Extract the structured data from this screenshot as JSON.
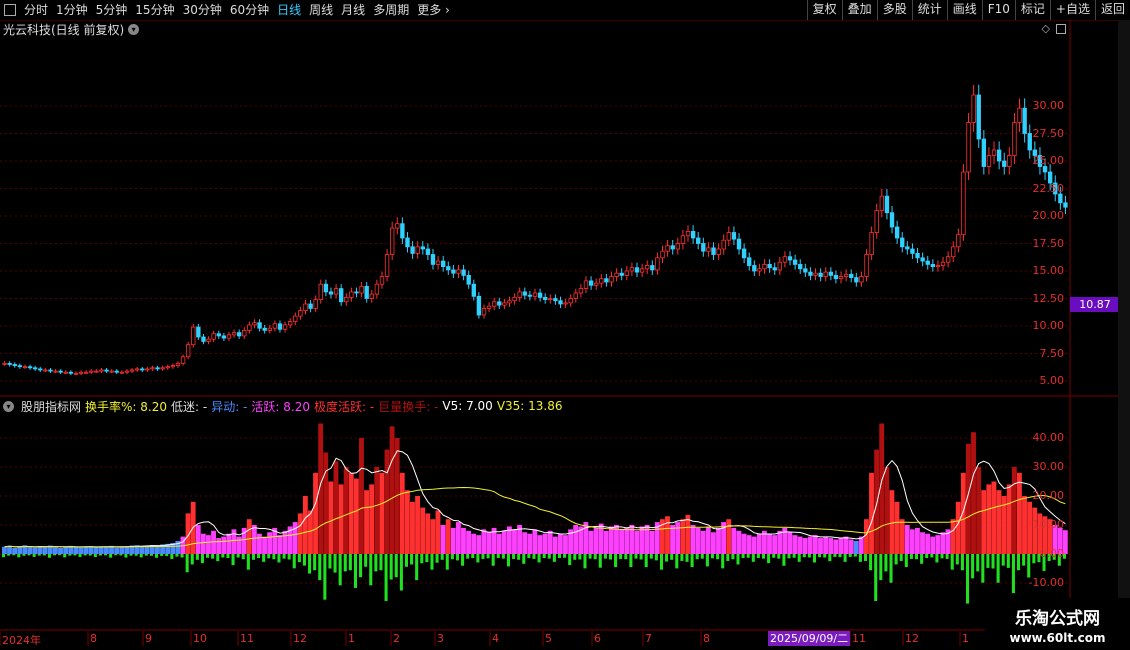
{
  "toolbar": {
    "periods": [
      "分时",
      "1分钟",
      "5分钟",
      "15分钟",
      "30分钟",
      "60分钟",
      "日线",
      "周线",
      "月线",
      "多周期",
      "更多"
    ],
    "active_index": 6,
    "right_buttons": [
      "复权",
      "叠加",
      "多股",
      "统计",
      "画线",
      "F10",
      "标记",
      "+自选",
      "返回"
    ]
  },
  "stock": {
    "name": "光云科技(日线 前复权)"
  },
  "price_axis": [
    "30.00",
    "27.50",
    "25.00",
    "22.50",
    "20.00",
    "17.50",
    "15.00",
    "12.50",
    "10.00",
    "7.50",
    "5.00"
  ],
  "current_price": "10.87",
  "indicator": {
    "name": "股朋指标网",
    "fields": [
      {
        "text": "换手率%: 8.20",
        "color": "#f0f030"
      },
      {
        "text": "低迷: -",
        "color": "#dddddd"
      },
      {
        "text": "异动: -",
        "color": "#4a8cff"
      },
      {
        "text": "活跃: 8.20",
        "color": "#ff40ff"
      },
      {
        "text": "极度活跃: -",
        "color": "#ff3030"
      },
      {
        "text": "巨量换手: -",
        "color": "#b01010"
      },
      {
        "text": "V5: 7.00",
        "color": "#ffffff"
      },
      {
        "text": "V35: 13.86",
        "color": "#f0f030"
      }
    ],
    "axis": [
      "40.00",
      "30.00",
      "20.00",
      "10.00",
      "0.00",
      "-10.00"
    ]
  },
  "dates": [
    "2024年",
    "8",
    "9",
    "10",
    "11",
    "12",
    "1",
    "2",
    "3",
    "4",
    "5",
    "6",
    "7",
    "8",
    "11",
    "12",
    "1"
  ],
  "date_tag": "2025/09/09/二",
  "brand": {
    "title": "乐淘公式网",
    "url": "www.60lt.com"
  },
  "colors": {
    "up": "#ff3030",
    "down": "#30d0ff",
    "grid": "#5a0000",
    "turnover_low": "#4a8cff",
    "turnover_active": "#ff40ff",
    "turnover_extreme": "#ff3030",
    "turnover_huge": "#b01010",
    "negative": "#20e020"
  },
  "chart_data": {
    "type": "candlestick",
    "ylim": [
      4,
      36
    ],
    "close": [
      6.6,
      6.5,
      6.4,
      6.3,
      6.3,
      6.2,
      6.1,
      6.0,
      6.0,
      5.9,
      5.9,
      5.8,
      5.8,
      5.7,
      5.7,
      5.8,
      5.8,
      5.9,
      5.9,
      6.0,
      5.9,
      5.9,
      5.8,
      5.8,
      5.9,
      6.0,
      6.1,
      6.0,
      6.1,
      6.2,
      6.1,
      6.2,
      6.3,
      6.4,
      6.6,
      7.2,
      8.3,
      9.9,
      9.0,
      8.6,
      8.8,
      9.3,
      9.1,
      8.9,
      9.2,
      9.4,
      9.1,
      9.6,
      10.1,
      10.3,
      9.8,
      9.6,
      9.8,
      10.2,
      9.7,
      10.1,
      10.4,
      10.9,
      11.4,
      12.0,
      11.6,
      12.4,
      13.8,
      13.1,
      12.9,
      13.4,
      12.2,
      12.6,
      13.1,
      13.0,
      13.6,
      12.5,
      12.9,
      13.8,
      14.5,
      16.5,
      18.9,
      19.3,
      18.0,
      17.2,
      16.6,
      17.2,
      17.0,
      16.5,
      15.6,
      15.9,
      15.4,
      15.1,
      14.8,
      15.1,
      14.6,
      13.8,
      12.7,
      11.0,
      11.6,
      11.8,
      12.2,
      11.9,
      12.1,
      12.3,
      12.6,
      13.1,
      12.8,
      12.7,
      13.0,
      12.6,
      12.4,
      12.5,
      12.3,
      12.0,
      12.1,
      12.5,
      13.0,
      13.4,
      14.1,
      13.7,
      13.9,
      14.3,
      14.0,
      14.5,
      14.8,
      14.6,
      15.0,
      15.3,
      14.9,
      15.2,
      15.5,
      15.1,
      16.2,
      16.8,
      17.3,
      17.0,
      17.5,
      18.2,
      18.6,
      18.0,
      17.5,
      16.8,
      17.1,
      16.5,
      17.0,
      17.8,
      18.5,
      17.9,
      17.0,
      16.2,
      15.5,
      15.0,
      15.2,
      15.6,
      15.3,
      15.1,
      15.8,
      16.3,
      16.0,
      15.6,
      15.2,
      14.9,
      14.6,
      14.8,
      14.5,
      14.9,
      14.6,
      14.3,
      14.5,
      14.7,
      14.4,
      14.0,
      14.5,
      16.5,
      18.5,
      20.5,
      21.8,
      20.3,
      19.0,
      18.0,
      17.2,
      17.0,
      16.6,
      16.2,
      15.9,
      15.6,
      15.4,
      15.5,
      15.8,
      16.3,
      17.2,
      18.3,
      24.0,
      28.5,
      31.0,
      27.0,
      24.5,
      25.5,
      26.0,
      25.0,
      24.5,
      25.5,
      28.5,
      29.8,
      27.5,
      26.0,
      25.5,
      24.5,
      24.0,
      23.0,
      22.0,
      21.2,
      20.8
    ],
    "turnover": [
      2.5,
      2.8,
      2.1,
      2.6,
      3.0,
      2.4,
      2.2,
      2.7,
      2.5,
      2.9,
      2.3,
      2.1,
      2.6,
      2.8,
      2.4,
      2.2,
      2.5,
      2.7,
      2.3,
      2.6,
      2.4,
      2.8,
      2.2,
      2.5,
      2.7,
      2.9,
      3.0,
      2.6,
      2.8,
      3.1,
      2.9,
      3.3,
      3.5,
      3.8,
      4.5,
      6.0,
      14.0,
      18.0,
      10.0,
      7.0,
      6.5,
      8.0,
      5.5,
      6.0,
      7.0,
      8.5,
      6.0,
      9.0,
      12.0,
      10.0,
      7.0,
      6.0,
      7.5,
      9.0,
      6.5,
      8.0,
      9.5,
      11.0,
      14.0,
      20.0,
      15.0,
      28.0,
      45.0,
      35.0,
      25.0,
      32.0,
      24.0,
      30.0,
      28.0,
      26.0,
      40.0,
      22.0,
      24.0,
      30.0,
      28.0,
      36.0,
      44.0,
      40.0,
      28.0,
      22.0,
      18.0,
      20.0,
      16.0,
      14.0,
      12.0,
      15.0,
      10.0,
      12.0,
      9.0,
      11.0,
      9.0,
      8.0,
      7.0,
      6.5,
      8.5,
      7.5,
      9.0,
      7.0,
      8.0,
      9.5,
      8.5,
      10.0,
      7.5,
      7.0,
      8.5,
      6.5,
      7.0,
      8.0,
      6.0,
      7.0,
      6.5,
      8.5,
      10.0,
      9.5,
      11.0,
      8.0,
      9.0,
      10.5,
      8.0,
      9.5,
      10.0,
      8.5,
      9.0,
      10.0,
      8.0,
      9.5,
      10.0,
      8.0,
      11.0,
      12.0,
      13.0,
      10.0,
      11.0,
      12.0,
      13.5,
      10.0,
      9.0,
      8.0,
      9.5,
      7.5,
      9.0,
      11.0,
      12.0,
      9.0,
      8.0,
      7.0,
      6.5,
      6.0,
      7.0,
      8.0,
      7.0,
      6.5,
      8.0,
      9.0,
      7.5,
      6.5,
      6.0,
      5.5,
      6.0,
      6.5,
      5.5,
      6.0,
      5.5,
      5.0,
      5.5,
      6.0,
      5.0,
      4.5,
      6.0,
      12.0,
      28.0,
      36.0,
      45.0,
      30.0,
      22.0,
      18.0,
      12.0,
      10.0,
      8.5,
      9.0,
      7.5,
      7.0,
      6.0,
      6.5,
      7.5,
      8.5,
      12.0,
      18.0,
      28.0,
      38.0,
      42.0,
      30.0,
      22.0,
      24.0,
      25.0,
      22.0,
      20.0,
      24.0,
      30.0,
      28.0,
      20.0,
      18.0,
      16.0,
      14.0,
      13.0,
      12.0,
      10.0,
      9.0,
      8.2
    ]
  }
}
